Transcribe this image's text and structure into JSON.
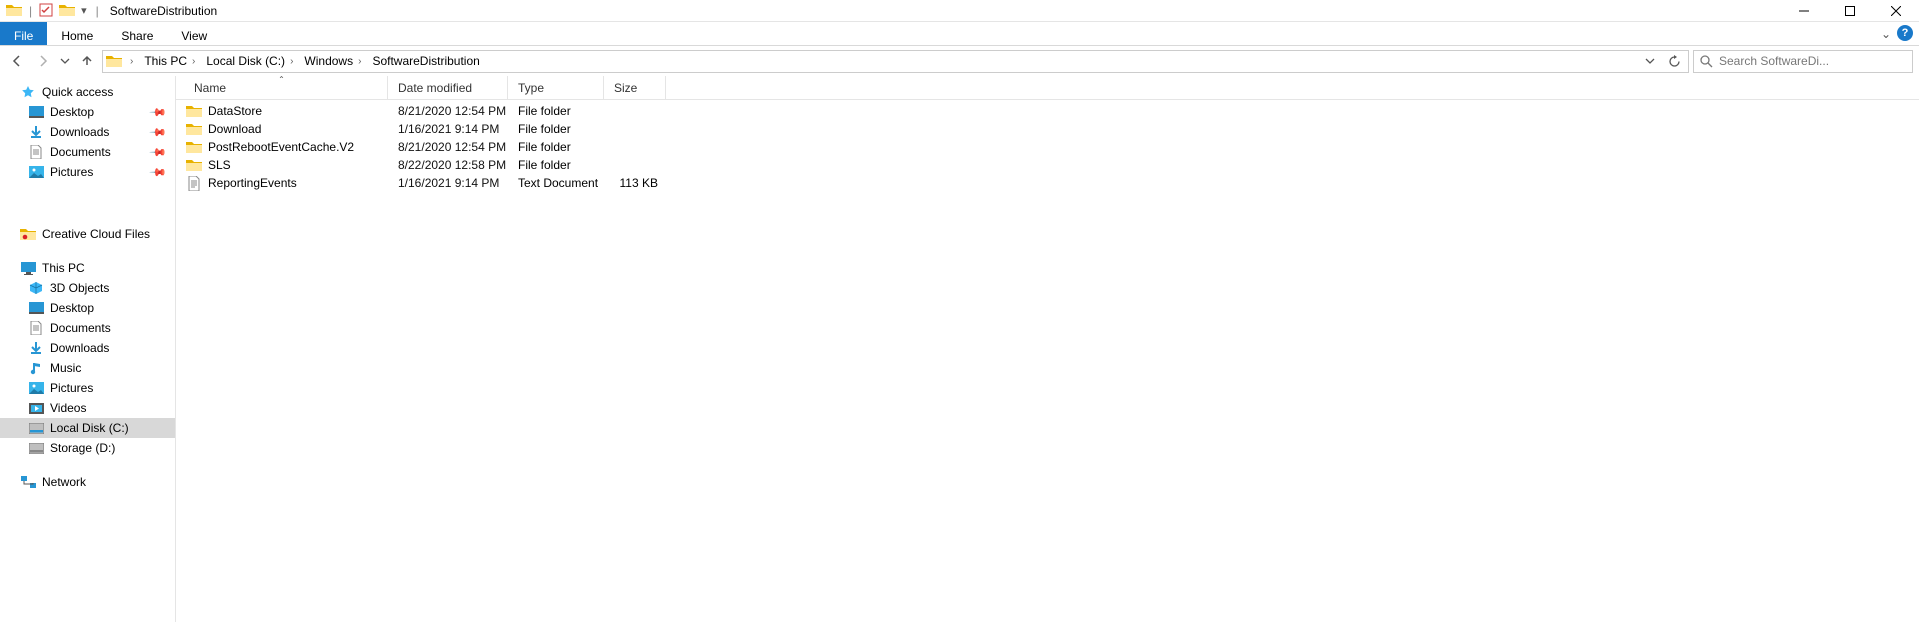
{
  "title": "SoftwareDistribution",
  "ribbon": {
    "file": "File",
    "home": "Home",
    "share": "Share",
    "view": "View"
  },
  "breadcrumb": [
    "This PC",
    "Local Disk (C:)",
    "Windows",
    "SoftwareDistribution"
  ],
  "search_placeholder": "Search SoftwareDi...",
  "columns": {
    "name": "Name",
    "date": "Date modified",
    "type": "Type",
    "size": "Size"
  },
  "nav": {
    "quick_access": "Quick access",
    "desktop": "Desktop",
    "downloads": "Downloads",
    "documents": "Documents",
    "pictures": "Pictures",
    "ccf": "Creative Cloud Files",
    "this_pc": "This PC",
    "objects3d": "3D Objects",
    "desktop2": "Desktop",
    "documents2": "Documents",
    "downloads2": "Downloads",
    "music": "Music",
    "pictures2": "Pictures",
    "videos": "Videos",
    "local_c": "Local Disk (C:)",
    "storage_d": "Storage (D:)",
    "network": "Network"
  },
  "items": [
    {
      "name": "DataStore",
      "date": "8/21/2020 12:54 PM",
      "type": "File folder",
      "size": "",
      "icon": "folder"
    },
    {
      "name": "Download",
      "date": "1/16/2021 9:14 PM",
      "type": "File folder",
      "size": "",
      "icon": "folder"
    },
    {
      "name": "PostRebootEventCache.V2",
      "date": "8/21/2020 12:54 PM",
      "type": "File folder",
      "size": "",
      "icon": "folder"
    },
    {
      "name": "SLS",
      "date": "8/22/2020 12:58 PM",
      "type": "File folder",
      "size": "",
      "icon": "folder"
    },
    {
      "name": "ReportingEvents",
      "date": "1/16/2021 9:14 PM",
      "type": "Text Document",
      "size": "113 KB",
      "icon": "text"
    }
  ]
}
